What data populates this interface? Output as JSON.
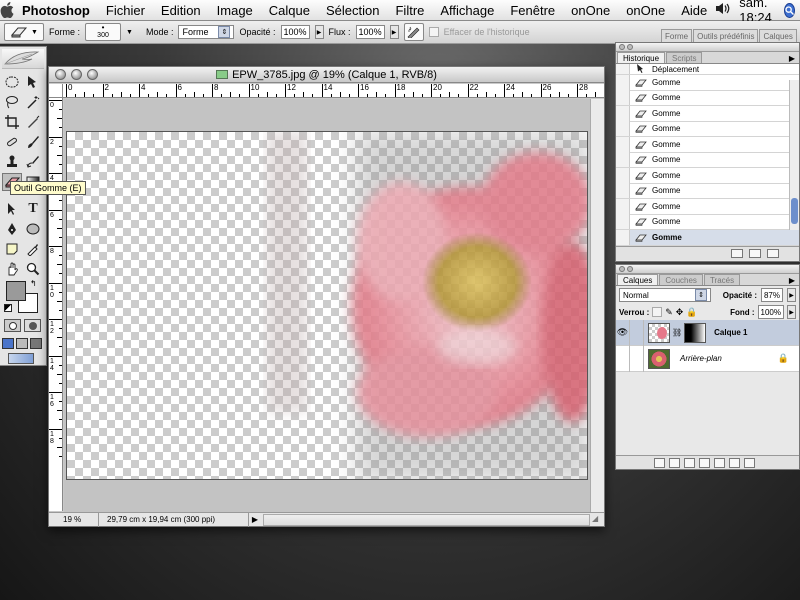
{
  "menubar": {
    "app_name": "Photoshop",
    "items": [
      "Fichier",
      "Edition",
      "Image",
      "Calque",
      "Sélection",
      "Filtre",
      "Affichage",
      "Fenêtre",
      "onOne",
      "onOne",
      "Aide"
    ],
    "clock": "sam. 18:24",
    "volume_icon": "speaker-icon",
    "spotlight_icon": "spotlight-icon"
  },
  "options_bar": {
    "shape_label": "Forme :",
    "brush_size": "300",
    "mode_label": "Mode :",
    "mode_value": "Forme",
    "opacity_label": "Opacité :",
    "opacity_value": "100%",
    "flow_label": "Flux :",
    "flow_value": "100%",
    "erase_history_label": "Effacer de l'historique"
  },
  "palette_well": {
    "tabs": [
      "Forme",
      "Outils prédéfinis",
      "Calques"
    ]
  },
  "toolbox": {
    "tooltip": "Outil Gomme (E)"
  },
  "document": {
    "title": "EPW_3785.jpg @ 19% (Calque 1, RVB/8)",
    "ruler_h": [
      "0",
      "2",
      "4",
      "6",
      "8",
      "10",
      "12",
      "14",
      "16",
      "18",
      "20",
      "22",
      "24",
      "26",
      "28"
    ],
    "ruler_v": [
      "0",
      "2",
      "4",
      "6",
      "8",
      "10",
      "12",
      "14",
      "16",
      "18"
    ],
    "zoom": "19 %",
    "doc_info": "29,79 cm x 19,94 cm (300 ppi)"
  },
  "history_palette": {
    "tabs": [
      "Historique",
      "Scripts"
    ],
    "items": [
      {
        "label": "Déplacement",
        "icon": "move-icon",
        "current": false
      },
      {
        "label": "Gomme",
        "icon": "eraser-icon",
        "current": false
      },
      {
        "label": "Gomme",
        "icon": "eraser-icon",
        "current": false
      },
      {
        "label": "Gomme",
        "icon": "eraser-icon",
        "current": false
      },
      {
        "label": "Gomme",
        "icon": "eraser-icon",
        "current": false
      },
      {
        "label": "Gomme",
        "icon": "eraser-icon",
        "current": false
      },
      {
        "label": "Gomme",
        "icon": "eraser-icon",
        "current": false
      },
      {
        "label": "Gomme",
        "icon": "eraser-icon",
        "current": false
      },
      {
        "label": "Gomme",
        "icon": "eraser-icon",
        "current": false
      },
      {
        "label": "Gomme",
        "icon": "eraser-icon",
        "current": false
      },
      {
        "label": "Gomme",
        "icon": "eraser-icon",
        "current": false
      },
      {
        "label": "Gomme",
        "icon": "eraser-icon",
        "current": true
      }
    ]
  },
  "layers_palette": {
    "tabs": [
      "Calques",
      "Couches",
      "Tracés"
    ],
    "blend_mode": "Normal",
    "opacity_label": "Opacité :",
    "opacity_value": "87%",
    "lock_label": "Verrou :",
    "fill_label": "Fond :",
    "fill_value": "100%",
    "layers": [
      {
        "name": "Calque 1",
        "selected": true,
        "visible": true,
        "has_mask": true
      },
      {
        "name": "Arrière-plan",
        "selected": false,
        "visible": false,
        "locked": true
      }
    ]
  },
  "colors": {
    "flower_pink": "#e8788a",
    "flower_center": "#c9a23a",
    "selection_blue": "#c2ccdd",
    "spotlight_blue": "#3d6fd0"
  }
}
